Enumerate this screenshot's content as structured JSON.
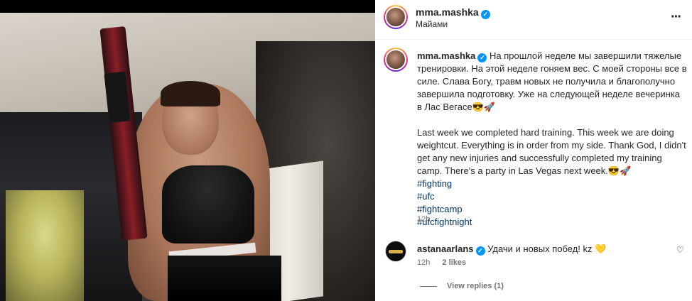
{
  "post": {
    "username": "mma.mashka",
    "location": "Майами",
    "more_icon": "more-horizontal-icon"
  },
  "caption": {
    "username": "mma.mashka",
    "text_ru": "На прошлой неделе мы завершили тяжелые тренировки. На этой неделе гоняем вес. С моей стороны все в силе. Слава Богу, травм новых не получила и благополучно завершила подготовку. Уже на следующей неделе вечеринка в Лас Вегасе😎🚀",
    "text_en": "Last week we completed hard training. This week we are doing weightcut. Everything is in order from my side. Thank God, I didn't get any new injuries and successfully completed my training camp. There's a party in Las Vegas next week.😎🚀",
    "hashtags": [
      "#fighting",
      "#ufc",
      "#fightcamp",
      "#ufcfightnight"
    ],
    "time": "12h"
  },
  "reply": {
    "username": "astanaarlans",
    "text": "Удачи и новых побед! kz 💛",
    "time": "12h",
    "likes": "2 likes",
    "view_replies": "View replies (1)"
  },
  "colors": {
    "verified": "#0095f6",
    "hashtag": "#00376b",
    "muted": "#737373"
  }
}
